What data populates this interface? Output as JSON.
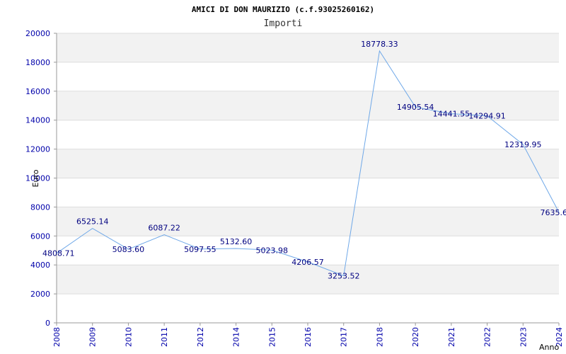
{
  "chart_data": {
    "type": "line",
    "title": "AMICI DI DON MAURIZIO (c.f.93025260162)",
    "subtitle": "Importi",
    "ylabel": "Euro",
    "xlabel": "Anno",
    "ylim": [
      0,
      20000
    ],
    "yticks": [
      0,
      2000,
      4000,
      6000,
      8000,
      10000,
      12000,
      14000,
      16000,
      18000,
      20000
    ],
    "grid": "horizontal bands",
    "line_color": "#6fa8e8",
    "band_color": "#f2f2f2",
    "tick_color": "#0000aa",
    "label_color": "#000080",
    "categories": [
      "2008",
      "2009",
      "2010",
      "2011",
      "2012",
      "2014",
      "2015",
      "2016",
      "2017",
      "2018",
      "2020",
      "2021",
      "2022",
      "2023",
      "2024"
    ],
    "values": [
      4808.71,
      6525.14,
      5083.6,
      6087.22,
      5097.55,
      5132.6,
      5023.98,
      4206.57,
      3253.52,
      18778.33,
      14905.54,
      14441.55,
      14294.91,
      12319.95,
      7635.6
    ],
    "data_labels": [
      "4808.71",
      "6525.14",
      "5083.60",
      "6087.22",
      "5097.55",
      "5132.60",
      "5023.98",
      "4206.57",
      "3253.52",
      "18778.33",
      "14905.54",
      "14441.55",
      "14294.91",
      "12319.95",
      "7635.6"
    ]
  }
}
